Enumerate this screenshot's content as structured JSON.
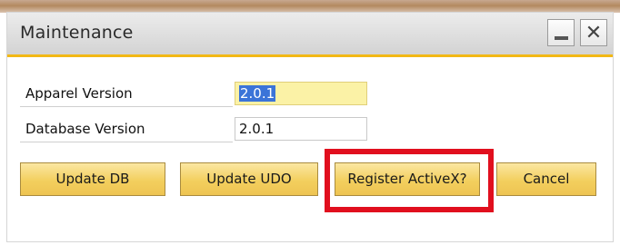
{
  "window": {
    "title": "Maintenance",
    "minimize_icon": "minimize-icon",
    "close_icon": "close-icon",
    "accent_color": "#f2b816"
  },
  "fields": {
    "apparel_version": {
      "label": "Apparel Version",
      "value": "2.0.1"
    },
    "database_version": {
      "label": "Database Version",
      "value": "2.0.1"
    }
  },
  "buttons": {
    "update_db": "Update DB",
    "update_udo": "Update UDO",
    "register_activex": "Register ActiveX?",
    "cancel": "Cancel"
  },
  "highlight": {
    "target": "register-activex-button",
    "color": "#e10f1e"
  }
}
